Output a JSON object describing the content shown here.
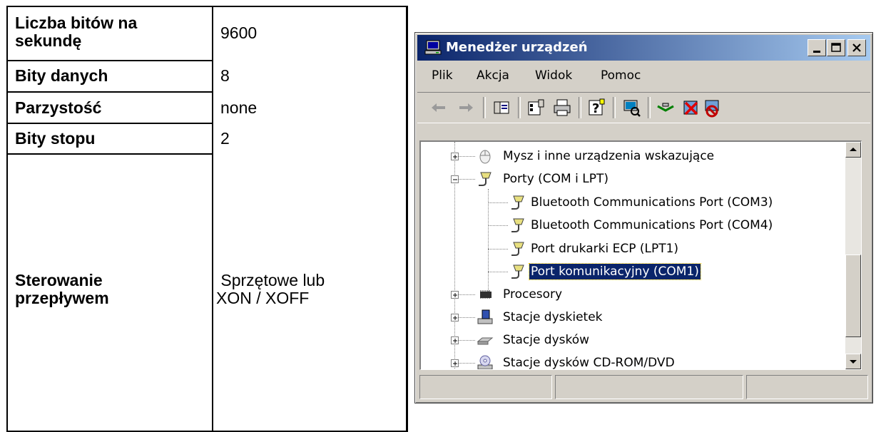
{
  "settings_table": {
    "rows": [
      {
        "label": "Liczba bitów na\nsekundę",
        "value": "9600"
      },
      {
        "label": "Bity danych",
        "value": "8"
      },
      {
        "label": "Parzystość",
        "value": "none"
      },
      {
        "label": "Bity stopu",
        "value": "2"
      },
      {
        "label": "Sterowanie\nprzepływem",
        "value": " Sprzętowe lub\nXON / XOFF"
      }
    ]
  },
  "window": {
    "title": "Menedżer urządzeń",
    "menu": {
      "file": "Plik",
      "action": "Akcja",
      "view": "Widok",
      "help": "Pomoc"
    },
    "tree": {
      "items": [
        {
          "label": "Mysz i inne urządzenia wskazujące",
          "icon": "mouse-icon"
        },
        {
          "label": "Porty (COM i LPT)",
          "icon": "port-icon"
        },
        {
          "label": "Bluetooth Communications Port (COM3)",
          "icon": "port-icon"
        },
        {
          "label": "Bluetooth Communications Port (COM4)",
          "icon": "port-icon"
        },
        {
          "label": "Port drukarki ECP (LPT1)",
          "icon": "port-icon"
        },
        {
          "label": "Port komunikacyjny (COM1)",
          "icon": "port-icon",
          "selected": true
        },
        {
          "label": "Procesory",
          "icon": "cpu-icon"
        },
        {
          "label": "Stacje dyskietek",
          "icon": "floppy-drive-icon"
        },
        {
          "label": "Stacje dysków",
          "icon": "disk-drive-icon"
        },
        {
          "label": "Stacje dysków CD-ROM/DVD",
          "icon": "cdrom-icon"
        }
      ]
    },
    "colors": {
      "titlebar_start": "#0a246a",
      "titlebar_end": "#a6caf0",
      "selection": "#0a246a",
      "face": "#d4d0c8"
    }
  }
}
